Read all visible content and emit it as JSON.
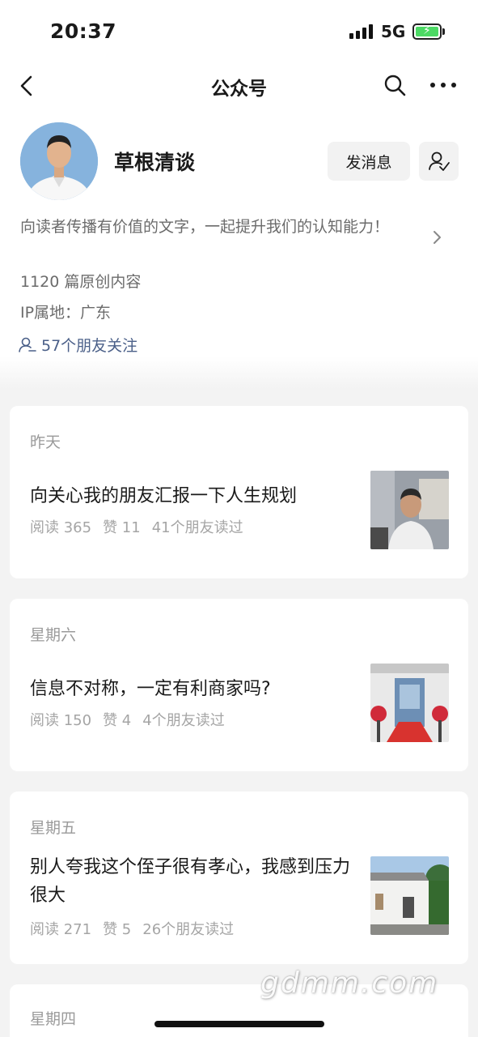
{
  "status_bar": {
    "time": "20:37",
    "network": "5G"
  },
  "nav": {
    "title": "公众号"
  },
  "profile": {
    "name": "草根清谈",
    "message_button": "发消息",
    "description": "向读者传播有价值的文字，一起提升我们的认知能力！",
    "original_count": "1120 篇原创内容",
    "ip_location": "IP属地：广东",
    "friends_follow": "57个朋友关注"
  },
  "articles": [
    {
      "date": "昨天",
      "title": "向关心我的朋友汇报一下人生规划",
      "reads": "阅读 365",
      "likes": "赞 11",
      "friends": "41个朋友读过"
    },
    {
      "date": "星期六",
      "title": "信息不对称，一定有利商家吗?",
      "reads": "阅读 150",
      "likes": "赞 4",
      "friends": "4个朋友读过"
    },
    {
      "date": "星期五",
      "title": "别人夸我这个侄子很有孝心，我感到压力很大",
      "reads": "阅读 271",
      "likes": "赞 5",
      "friends": "26个朋友读过"
    },
    {
      "date": "星期四"
    }
  ],
  "watermark": "gdmm.com",
  "colors": {
    "link": "#4a5f88",
    "muted": "#6b6b6b",
    "battery": "#4cd964"
  }
}
